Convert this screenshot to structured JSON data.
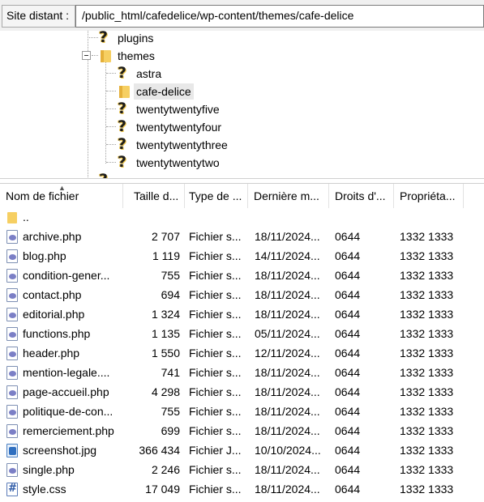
{
  "remote": {
    "label": "Site distant :",
    "path": "/public_html/cafedelice/wp-content/themes/cafe-delice"
  },
  "tree": {
    "items": [
      {
        "name": "plugins",
        "icon": "question-folder-icon",
        "selected": false
      },
      {
        "name": "themes",
        "icon": "folder-icon",
        "selected": false,
        "expanded": true
      },
      {
        "name": "astra",
        "icon": "question-folder-icon",
        "selected": false
      },
      {
        "name": "cafe-delice",
        "icon": "folder-icon",
        "selected": true
      },
      {
        "name": "twentytwentyfive",
        "icon": "question-folder-icon",
        "selected": false
      },
      {
        "name": "twentytwentyfour",
        "icon": "question-folder-icon",
        "selected": false
      },
      {
        "name": "twentytwentythree",
        "icon": "question-folder-icon",
        "selected": false
      },
      {
        "name": "twentytwentytwo",
        "icon": "question-folder-icon",
        "selected": false
      }
    ]
  },
  "list": {
    "columns": [
      "Nom de fichier",
      "Taille d...",
      "Type de ...",
      "Dernière m...",
      "Droits d'...",
      "Propriéta..."
    ],
    "parent_label": "..",
    "rows": [
      {
        "name": "archive.php",
        "icon": "php-file-icon",
        "size": "2 707",
        "type": "Fichier s...",
        "date": "18/11/2024...",
        "perm": "0644",
        "owner": "1332 1333"
      },
      {
        "name": "blog.php",
        "icon": "php-file-icon",
        "size": "1 119",
        "type": "Fichier s...",
        "date": "14/11/2024...",
        "perm": "0644",
        "owner": "1332 1333"
      },
      {
        "name": "condition-gener...",
        "icon": "php-file-icon",
        "size": "755",
        "type": "Fichier s...",
        "date": "18/11/2024...",
        "perm": "0644",
        "owner": "1332 1333"
      },
      {
        "name": "contact.php",
        "icon": "php-file-icon",
        "size": "694",
        "type": "Fichier s...",
        "date": "18/11/2024...",
        "perm": "0644",
        "owner": "1332 1333"
      },
      {
        "name": "editorial.php",
        "icon": "php-file-icon",
        "size": "1 324",
        "type": "Fichier s...",
        "date": "18/11/2024...",
        "perm": "0644",
        "owner": "1332 1333"
      },
      {
        "name": "functions.php",
        "icon": "php-file-icon",
        "size": "1 135",
        "type": "Fichier s...",
        "date": "05/11/2024...",
        "perm": "0644",
        "owner": "1332 1333"
      },
      {
        "name": "header.php",
        "icon": "php-file-icon",
        "size": "1 550",
        "type": "Fichier s...",
        "date": "12/11/2024...",
        "perm": "0644",
        "owner": "1332 1333"
      },
      {
        "name": "mention-legale....",
        "icon": "php-file-icon",
        "size": "741",
        "type": "Fichier s...",
        "date": "18/11/2024...",
        "perm": "0644",
        "owner": "1332 1333"
      },
      {
        "name": "page-accueil.php",
        "icon": "php-file-icon",
        "size": "4 298",
        "type": "Fichier s...",
        "date": "18/11/2024...",
        "perm": "0644",
        "owner": "1332 1333"
      },
      {
        "name": "politique-de-con...",
        "icon": "php-file-icon",
        "size": "755",
        "type": "Fichier s...",
        "date": "18/11/2024...",
        "perm": "0644",
        "owner": "1332 1333"
      },
      {
        "name": "remerciement.php",
        "icon": "php-file-icon",
        "size": "699",
        "type": "Fichier s...",
        "date": "18/11/2024...",
        "perm": "0644",
        "owner": "1332 1333"
      },
      {
        "name": "screenshot.jpg",
        "icon": "jpg-file-icon",
        "size": "366 434",
        "type": "Fichier J...",
        "date": "10/10/2024...",
        "perm": "0644",
        "owner": "1332 1333"
      },
      {
        "name": "single.php",
        "icon": "php-file-icon",
        "size": "2 246",
        "type": "Fichier s...",
        "date": "18/11/2024...",
        "perm": "0644",
        "owner": "1332 1333"
      },
      {
        "name": "style.css",
        "icon": "css-file-icon",
        "size": "17 049",
        "type": "Fichier s...",
        "date": "18/11/2024...",
        "perm": "0644",
        "owner": "1332 1333"
      }
    ]
  },
  "colors": {
    "folder": "#f6cf62",
    "php_icon": "#7b7fc6",
    "selection": "#e8e8e8"
  }
}
